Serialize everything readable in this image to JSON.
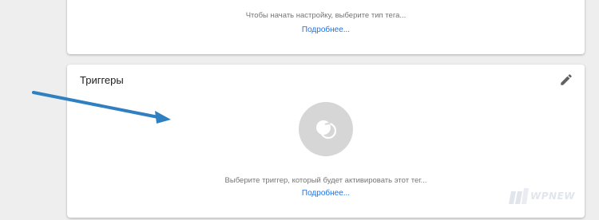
{
  "tag_section": {
    "hint": "Чтобы начать настройку, выберите тип тега...",
    "more_link": "Подробнее..."
  },
  "triggers_section": {
    "title": "Триггеры",
    "hint": "Выберите триггер, который будет активировать этот тег...",
    "more_link": "Подробнее...",
    "edit_icon": "pencil-icon",
    "trigger_icon": "trigger-icon"
  },
  "annotation": {
    "arrow_color": "#2f7fc1"
  },
  "watermark": {
    "text": "WPNEW"
  },
  "colors": {
    "link": "#1a73e8",
    "background": "#eeeeee",
    "card": "#ffffff"
  }
}
